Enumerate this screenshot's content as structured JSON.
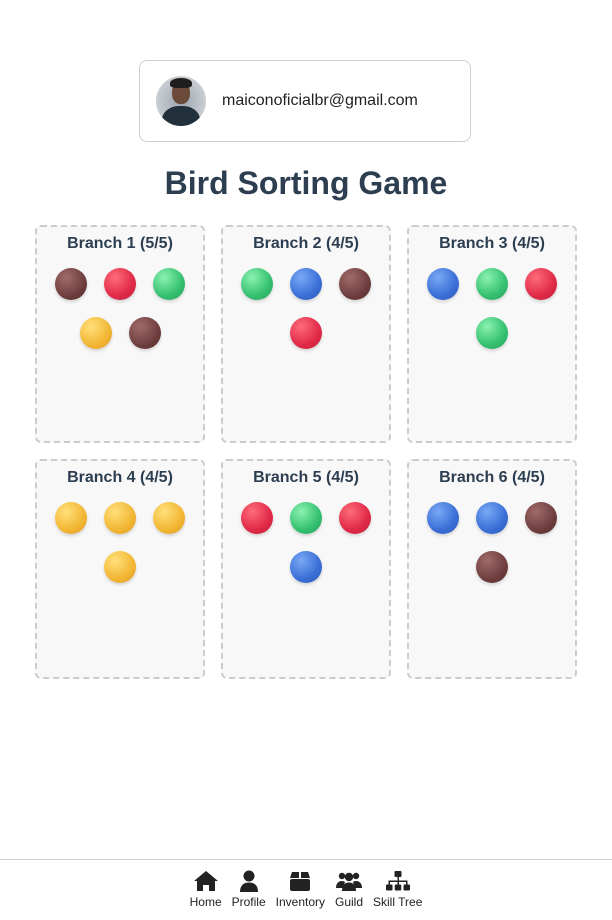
{
  "user": {
    "email": "maiconoficialbr@gmail.com"
  },
  "title": "Bird Sorting Game",
  "branches": [
    {
      "title": "Branch 1 (5/5)",
      "birds": [
        "brown",
        "red",
        "green",
        "yellow",
        "brown"
      ]
    },
    {
      "title": "Branch 2 (4/5)",
      "birds": [
        "green",
        "blue",
        "brown",
        "red"
      ]
    },
    {
      "title": "Branch 3 (4/5)",
      "birds": [
        "blue",
        "green",
        "red",
        "green"
      ]
    },
    {
      "title": "Branch 4 (4/5)",
      "birds": [
        "yellow",
        "yellow",
        "yellow",
        "yellow"
      ]
    },
    {
      "title": "Branch 5 (4/5)",
      "birds": [
        "red",
        "green",
        "red",
        "blue"
      ]
    },
    {
      "title": "Branch 6 (4/5)",
      "birds": [
        "blue",
        "blue",
        "brown",
        "brown"
      ]
    }
  ],
  "colors": {
    "brown": "#6b3b3b",
    "red": "#e02a48",
    "green": "#35c070",
    "blue": "#3a6fd6",
    "yellow": "#f2b634"
  },
  "nav": [
    {
      "label": "Home",
      "icon": "home-icon"
    },
    {
      "label": "Profile",
      "icon": "person-icon"
    },
    {
      "label": "Inventory",
      "icon": "box-icon"
    },
    {
      "label": "Guild",
      "icon": "users-icon"
    },
    {
      "label": "Skill Tree",
      "icon": "sitemap-icon"
    }
  ]
}
